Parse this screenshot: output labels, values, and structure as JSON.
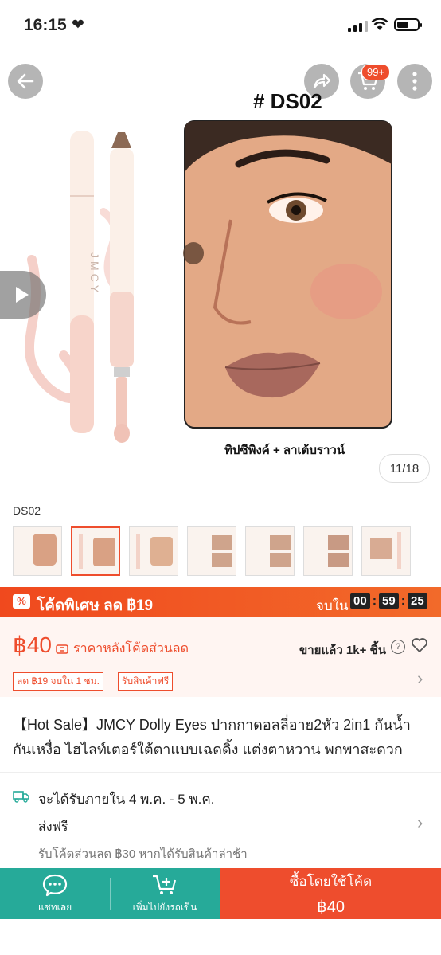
{
  "status": {
    "time": "16:15"
  },
  "gallery": {
    "shade_title": "# DS02",
    "caption": "ทิปซีพิงค์ + ลาเต้บราวน์",
    "counter": "11/18",
    "cart_badge": "99+",
    "brand_on_pencil": "JMCY"
  },
  "variant": {
    "label": "DS02"
  },
  "promo": {
    "text": "โค้ดพิเศษ ลด ฿19",
    "end_label": "จบใน",
    "timer": [
      "00",
      "59",
      "25"
    ]
  },
  "price": {
    "value": "฿40",
    "note": "ราคาหลังโค้ดส่วนลด",
    "sold": "ขายแล้ว 1k+ ชิ้น",
    "tags": [
      "ลด ฿19 จบใน 1 ชม.",
      "รับสินค้าฟรี"
    ]
  },
  "product": {
    "title": "【Hot Sale】JMCY Dolly Eyes ปากกาดอลลี่อาย2หัว 2in1 กันน้ำกันเหงื่อ ไฮไลท์เตอร์ใต้ตาแบบเฉดดิ้ง แต่งตาหวาน พกพาสะดวก"
  },
  "shipping": {
    "date": "จะได้รับภายใน 4 พ.ค. - 5 พ.ค.",
    "free": "ส่งฟรี",
    "note": "รับโค้ดส่วนลด ฿30 หากได้รับสินค้าล่าช้า"
  },
  "bottom": {
    "chat": "แชทเลย",
    "add_cart": "เพิ่มไปยังรถเข็น",
    "buy_line1": "ซื้อโดยใช้โค้ด",
    "buy_line2": "฿40"
  },
  "colors": {
    "accent": "#ee4d2d",
    "teal": "#26aa99"
  }
}
